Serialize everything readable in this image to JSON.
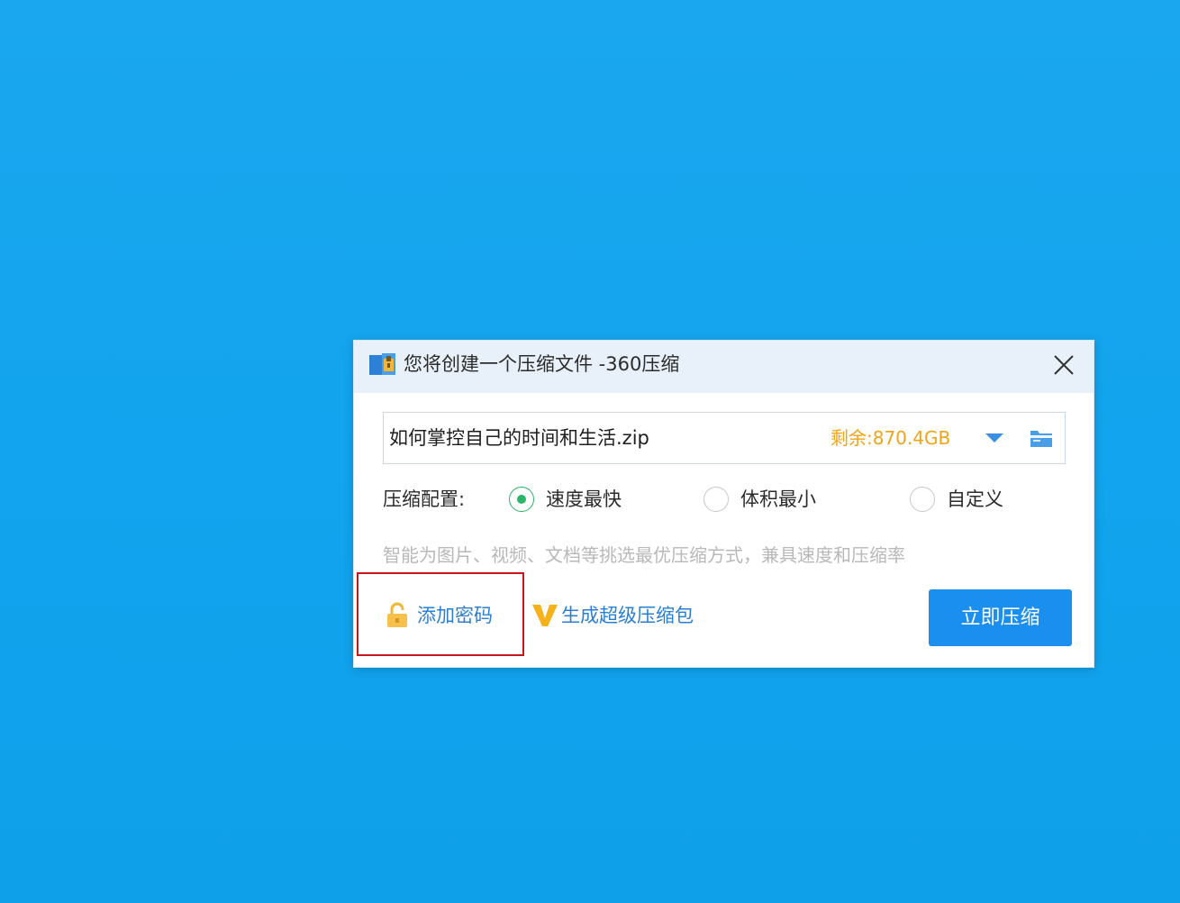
{
  "dialog": {
    "title": "您将创建一个压缩文件 -360压缩",
    "filename": "如何掌控自己的时间和生活.zip",
    "free_space": "剩余:870.4GB",
    "config_label": "压缩配置:",
    "options": [
      {
        "label": "速度最快",
        "selected": true
      },
      {
        "label": "体积最小",
        "selected": false
      },
      {
        "label": "自定义",
        "selected": false
      }
    ],
    "hint": "智能为图片、视频、文档等挑选最优压缩方式，兼具速度和压缩率",
    "add_password_label": "添加密码",
    "super_package_label": "生成超级压缩包",
    "compress_button_label": "立即压缩"
  },
  "colors": {
    "desktop_bg": "#12a4ee",
    "accent": "#1a8ff0",
    "link": "#2a7fd4",
    "free_space": "#f0a418",
    "radio_selected": "#2bb36a",
    "highlight": "#c8161d"
  },
  "icons": {
    "app": "archive-app-icon",
    "close": "close-icon",
    "dropdown": "dropdown-arrow-icon",
    "folder": "folder-icon",
    "lock": "unlocked-padlock-icon",
    "vip": "v-badge-icon"
  }
}
